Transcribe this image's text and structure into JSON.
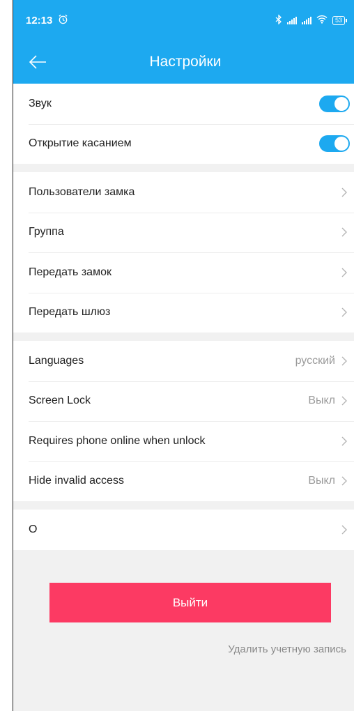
{
  "status_bar": {
    "time": "12:13",
    "battery": "53"
  },
  "header": {
    "title": "Настройки"
  },
  "group1": [
    {
      "label": "Звук",
      "toggle": true
    },
    {
      "label": "Открытие касанием",
      "toggle": true
    }
  ],
  "group2": [
    {
      "label": "Пользователи замка"
    },
    {
      "label": "Группа"
    },
    {
      "label": "Передать замок"
    },
    {
      "label": "Передать шлюз"
    }
  ],
  "group3": [
    {
      "label": "Languages",
      "value": "русский"
    },
    {
      "label": "Screen Lock",
      "value": "Выкл"
    },
    {
      "label": "Requires phone online when unlock",
      "value": ""
    },
    {
      "label": "Hide invalid access",
      "value": "Выкл"
    }
  ],
  "group4": [
    {
      "label": "O"
    }
  ],
  "actions": {
    "logout_label": "Выйти",
    "delete_account_label": "Удалить учетную запись"
  },
  "colors": {
    "accent": "#1da9f0",
    "logout": "#fc3a63"
  }
}
